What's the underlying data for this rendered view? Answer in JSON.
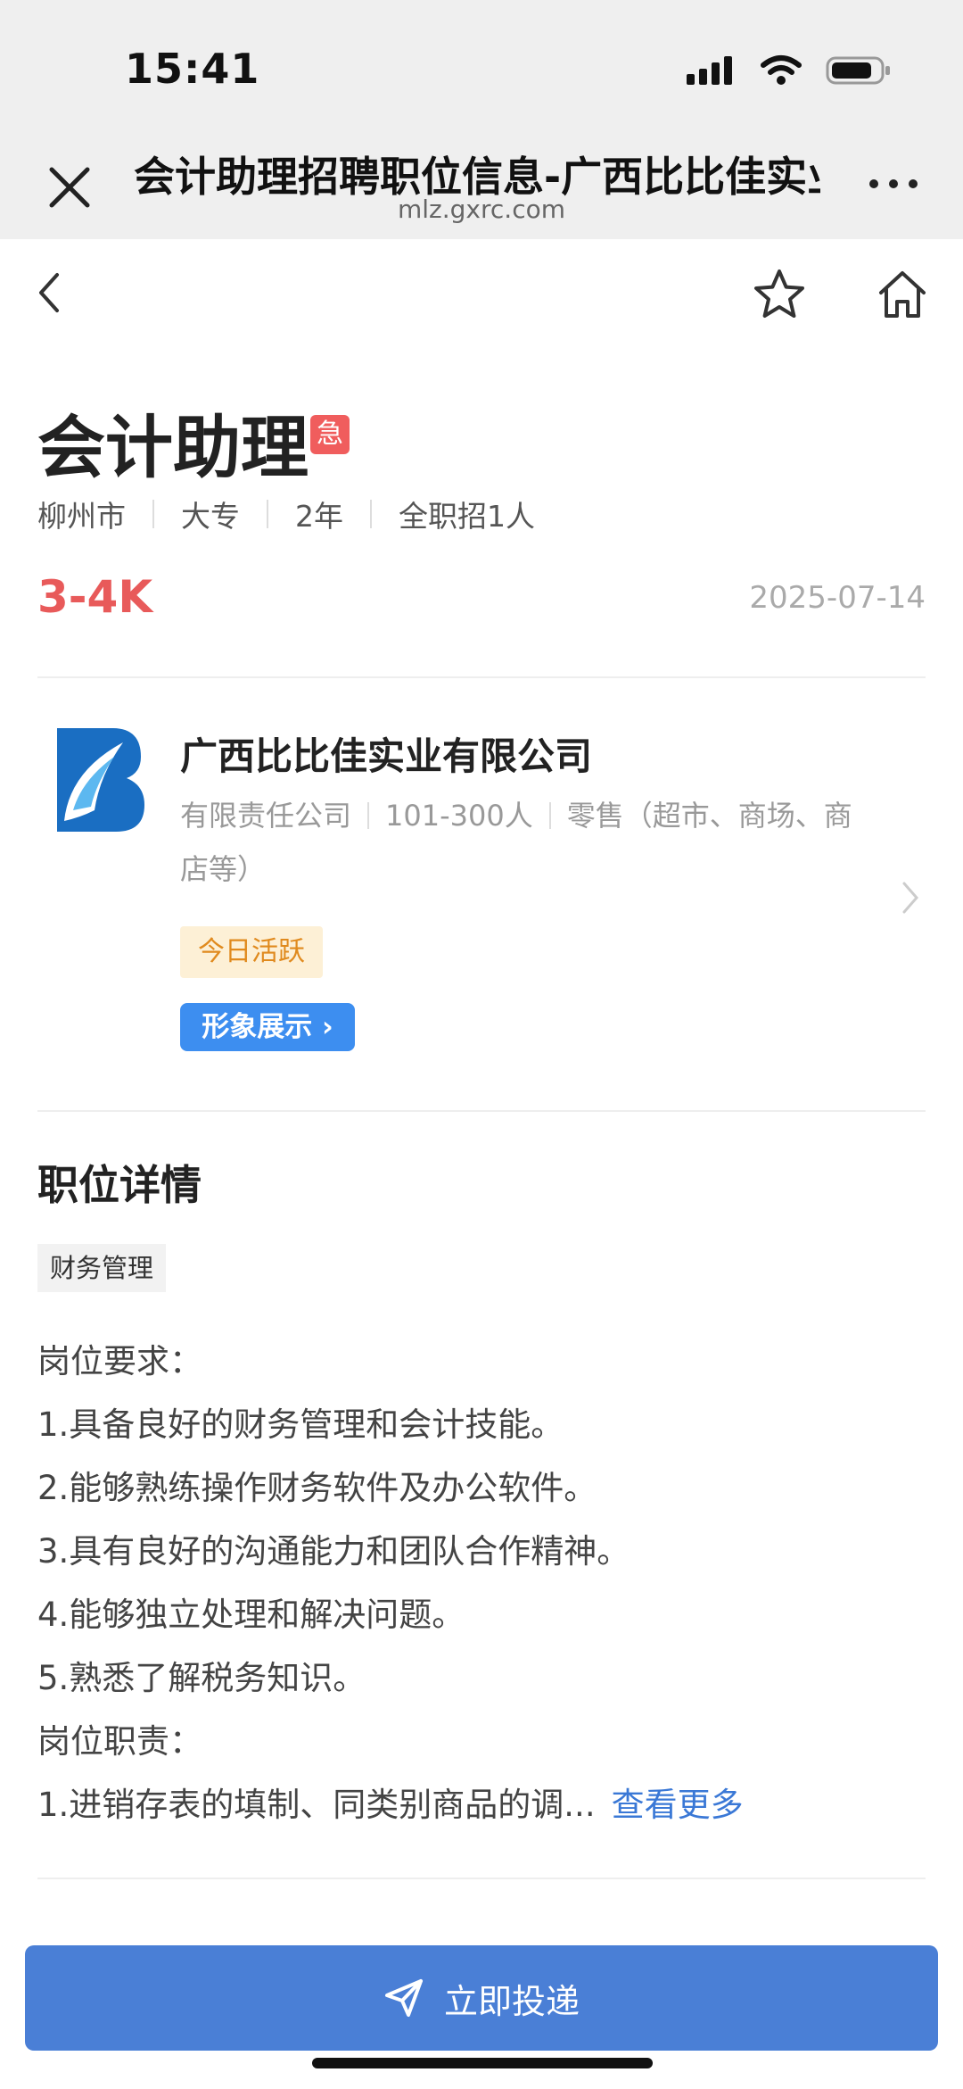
{
  "status_bar": {
    "time": "15:41"
  },
  "browser": {
    "title": "会计助理招聘职位信息-广西比比佳实业有限公司",
    "domain": "mlz.gxrc.com"
  },
  "job": {
    "title": "会计助理",
    "urgent_badge": "急",
    "meta": [
      "柳州市",
      "大专",
      "2年",
      "全职招1人"
    ],
    "salary": "3-4K",
    "date": "2025-07-14"
  },
  "company": {
    "name": "广西比比佳实业有限公司",
    "type": "有限责任公司",
    "size": "101-300人",
    "industry": "零售（超市、商场、商店等）",
    "active_tag": "今日活跃",
    "showcase_label": "形象展示",
    "logo_letter": "B"
  },
  "details": {
    "section_title": "职位详情",
    "category_tag": "财务管理",
    "lines": [
      "岗位要求：",
      "1.具备良好的财务管理和会计技能。",
      "2.能够熟练操作财务软件及办公软件。",
      "3.具有良好的沟通能力和团队合作精神。",
      "4.能够独立处理和解决问题。",
      "5.熟悉了解税务知识。",
      "岗位职责："
    ],
    "truncated_line": "1.进销存表的填制、同类别商品的调...",
    "see_more": "查看更多"
  },
  "apply_button": {
    "label": "立即投递"
  },
  "colors": {
    "salary": "#e85a5a",
    "urgent": "#f05d5d",
    "primary": "#4a7fd6",
    "link": "#3a78d6",
    "logo_blue": "#1a6ec2"
  },
  "icons": [
    "close-icon",
    "more-icon",
    "back-icon",
    "star-icon",
    "home-icon",
    "chevron-right-icon",
    "send-icon",
    "signal-icon",
    "wifi-icon",
    "battery-icon"
  ]
}
